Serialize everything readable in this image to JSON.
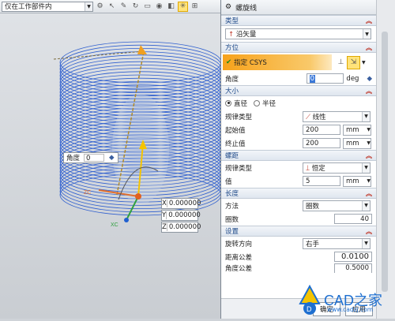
{
  "toolbar": {
    "filter_value": "仅在工作部件内"
  },
  "panel": {
    "title": "螺旋线",
    "sections": {
      "type": "类型",
      "orient": "方位",
      "size": "大小",
      "pitch": "螺距",
      "length": "长度",
      "settings": "设置"
    },
    "type_value": "沿矢量",
    "csys_label": "指定 CSYS",
    "angle_label": "角度",
    "angle_value": "0",
    "angle_unit": "deg",
    "radio_diameter": "直径",
    "radio_radius": "半径",
    "law_label": "规律类型",
    "law_value_size": "线性",
    "start_label": "起始值",
    "start_value": "200",
    "end_label": "终止值",
    "end_value": "200",
    "unit_mm": "mm",
    "law_value_pitch": "恒定",
    "value_label": "值",
    "pitch_value": "5",
    "method_label": "方法",
    "method_value": "圈数",
    "turns_label": "圈数",
    "turns_value": "40",
    "rot_label": "旋转方向",
    "rot_value": "右手",
    "dist_tol_label": "距离公差",
    "dist_tol_value": "0.0100",
    "ang_tol_label": "角度公差",
    "ang_tol_value": "0.5000",
    "ok_label": "确定",
    "apply_label": "应用"
  },
  "viewport": {
    "angle_label": "角度",
    "angle_value": "0",
    "x_label": "X",
    "x_value": "0.000000",
    "y_label": "Y",
    "y_value": "0.000000",
    "z_label": "Z",
    "z_value": "0.000000",
    "axis_x": "XC",
    "axis_z": "ZC"
  },
  "watermark": {
    "text": "CAD之家",
    "url": "www.cadzj.com"
  }
}
